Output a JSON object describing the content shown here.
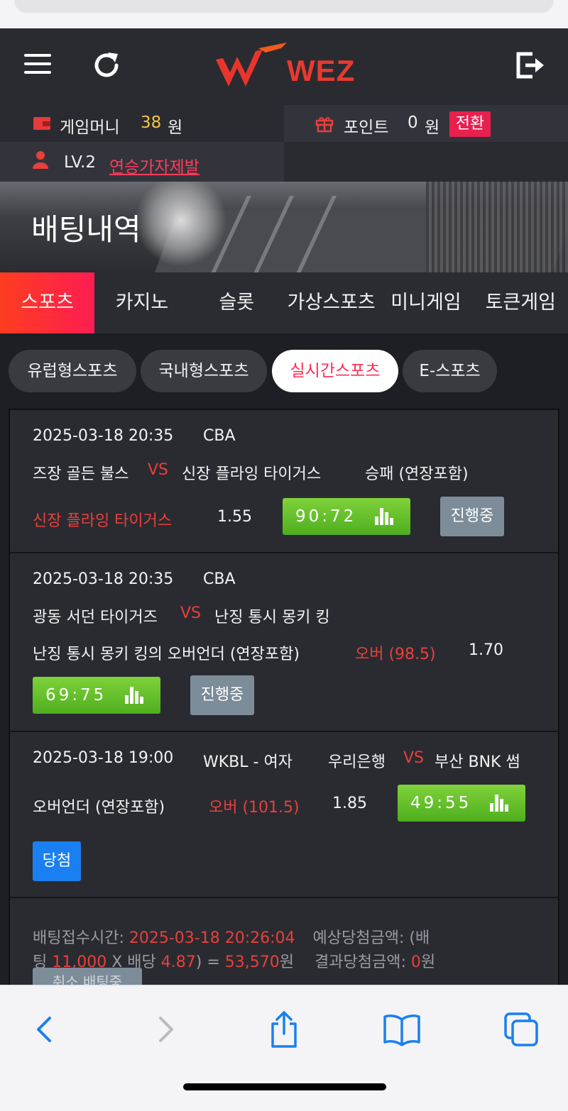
{
  "header": {
    "logo_text": "WEZ",
    "menu_icon": "hamburger-menu-icon",
    "refresh_icon": "refresh-icon",
    "logout_icon": "logout-icon"
  },
  "account": {
    "game_money_label": "게임머니",
    "game_money_value": "38",
    "game_money_unit": "원",
    "point_label": "포인트",
    "point_value": "0",
    "point_unit": "원",
    "swap_label": "전환",
    "level": "LV.2",
    "level_link": "연승가자제발"
  },
  "banner": {
    "title": "배팅내역"
  },
  "tabs": [
    {
      "label": "스포츠",
      "active": true
    },
    {
      "label": "카지노",
      "active": false
    },
    {
      "label": "슬롯",
      "active": false
    },
    {
      "label": "가상스포츠",
      "active": false
    },
    {
      "label": "미니게임",
      "active": false
    },
    {
      "label": "토큰게임",
      "active": false
    }
  ],
  "subtabs": [
    {
      "label": "유럽형스포츠",
      "active": false
    },
    {
      "label": "국내형스포츠",
      "active": false
    },
    {
      "label": "실시간스포츠",
      "active": true
    },
    {
      "label": "E-스포츠",
      "active": false
    }
  ],
  "bets": [
    {
      "datetime": "2025-03-18 20:35",
      "league": "CBA",
      "home": "즈장 골든 불스",
      "vs": "VS",
      "away": "신장 플라잉 타이거스",
      "market": "승패 (연장포함)",
      "pick": "신장 플라잉 타이거스",
      "odds": "1.55",
      "score": "90:72",
      "status": "진행중"
    },
    {
      "datetime": "2025-03-18 20:35",
      "league": "CBA",
      "home": "광동 서던 타이거즈",
      "vs": "VS",
      "away": "난징 통시 몽키 킹",
      "market": "난징 통시 몽키 킹의 오버언더 (연장포함)",
      "pick": "오버 (98.5)",
      "odds": "1.70",
      "score": "69:75",
      "status": "진행중"
    },
    {
      "datetime": "2025-03-18 19:00",
      "league": "WKBL - 여자",
      "home": "우리은행",
      "vs": "VS",
      "away": "부산 BNK 썸",
      "market": "오버언더 (연장포함)",
      "pick": "오버 (101.5)",
      "odds": "1.85",
      "score": "49:55",
      "status": "당첨"
    }
  ],
  "summary": {
    "receipt_label": "배팅접수시간:",
    "receipt_time": "2025-03-18 20:26:04",
    "expected_label_a": "예상당첨금액: (배",
    "expected_label_b": "팅",
    "stake": "11,000",
    "times": "X 배당",
    "total_odds": "4.87",
    "eq": ") =",
    "payout": "53,570",
    "won": "원",
    "result_label": "결과당첨금액:",
    "result_value": "0",
    "result_unit": "원",
    "cancel_label": "취소 배팅중"
  },
  "browser": {
    "back_icon": "back-chevron-icon",
    "forward_icon": "forward-chevron-icon",
    "share_icon": "share-icon",
    "bookmarks_icon": "book-icon",
    "tabs_icon": "tabs-icon"
  }
}
